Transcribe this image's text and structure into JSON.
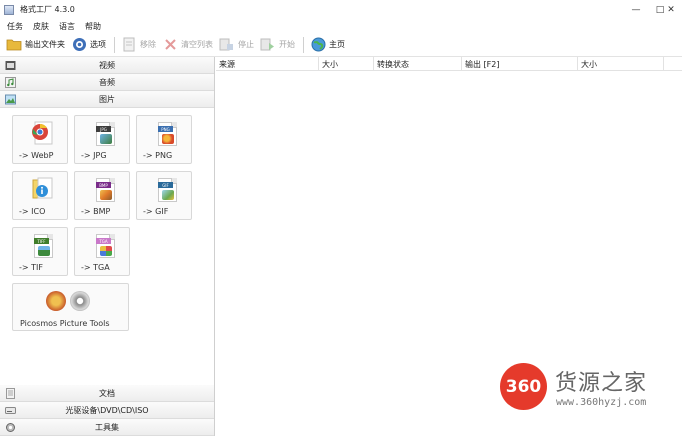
{
  "window": {
    "title": "格式工厂 4.3.0",
    "controls": {
      "minimize": "—",
      "maximize": "□",
      "close": "✕"
    }
  },
  "menu": [
    "任务",
    "皮肤",
    "语言",
    "帮助"
  ],
  "toolbar": {
    "output_folder": "输出文件夹",
    "options": "选项",
    "remove": "移除",
    "clear_list": "清空列表",
    "stop": "停止",
    "start": "开始",
    "home": "主页"
  },
  "categories": {
    "video": "视频",
    "audio": "音频",
    "image": "图片",
    "document": "文档",
    "optical": "光驱设备\\DVD\\CD\\ISO",
    "tools": "工具集"
  },
  "formats": [
    {
      "label": "-> WebP",
      "badge": "",
      "color": "#3a7bd5"
    },
    {
      "label": "-> JPG",
      "badge": "JPG",
      "color": "#3d3d3d"
    },
    {
      "label": "-> PNG",
      "badge": "PNG",
      "color": "#3a6fb0"
    },
    {
      "label": "-> ICO",
      "badge": "",
      "color": "#e0b020"
    },
    {
      "label": "-> BMP",
      "badge": "BMP",
      "color": "#7a2c8a"
    },
    {
      "label": "-> GIF",
      "badge": "GIF",
      "color": "#2a6a9a"
    },
    {
      "label": "-> TIF",
      "badge": "TIFF",
      "color": "#3f7d2a"
    },
    {
      "label": "-> TGA",
      "badge": "TGA",
      "color": "#c978c9"
    }
  ],
  "picosmos": {
    "label": "Picosmos Picture Tools"
  },
  "table": {
    "columns": [
      "来源",
      "大小",
      "转换状态",
      "输出 [F2]",
      "大小"
    ]
  },
  "watermark": {
    "logo": "360",
    "brand": "货源之家",
    "url": "www.360hyzj.com"
  }
}
